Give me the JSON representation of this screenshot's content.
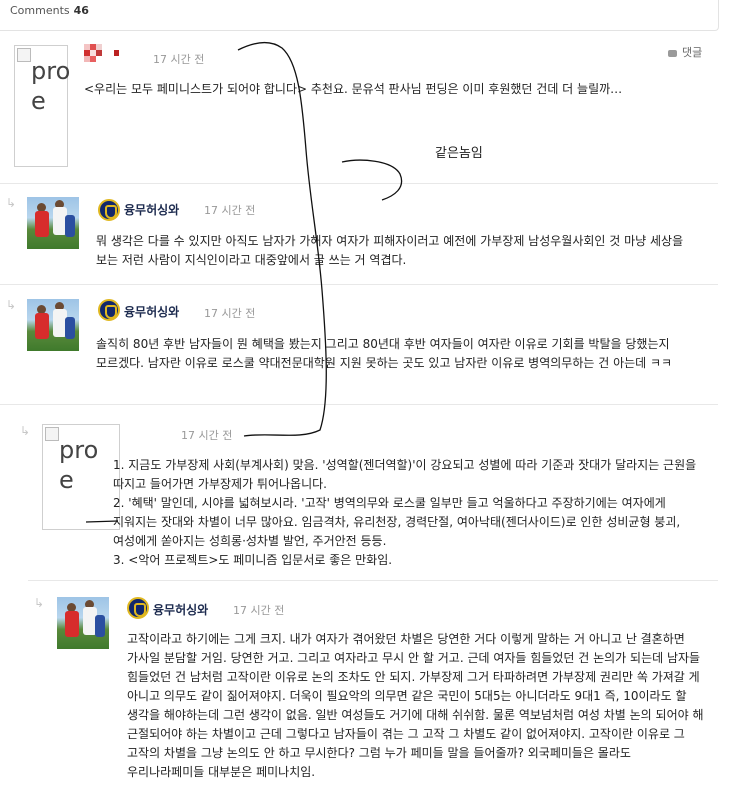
{
  "header": {
    "comments_label": "Comments",
    "comments_count": "46"
  },
  "reply_label": "댓글",
  "annotation_text": "같은놈임",
  "comments": [
    {
      "avatar_alt": "pro\ne",
      "author": "",
      "time": "17 시간 전",
      "text": "<우리는 모두 페미니스트가 되어야 합니다> 추천요. 문유석 판사님 펀딩은 이미 후원했던 건데 더 늘릴까…"
    },
    {
      "author": "융무허싱와",
      "time": "17 시간 전",
      "text": "뭐 생각은 다를 수 있지만 아직도 남자가 가해자 여자가 피해자이러고 예전에 가부장제 남성우월사회인 것 마냥 세상을 보는 저런 사람이 지식인이라고 대중앞에서 글 쓰는 거 역겹다."
    },
    {
      "author": "융무허싱와",
      "time": "17 시간 전",
      "text": "솔직히 80년 후반 남자들이 뭔 혜택을 봤는지 그리고 80년대 후반 여자들이 여자란 이유로 기회를 박탈을 당했는지 모르겠다. 남자란 이유로 로스쿨 약대전문대학원 지원 못하는 곳도 있고 남자란 이유로 병역의무하는 건 아는데 ㅋㅋ"
    },
    {
      "avatar_alt": "pro\ne",
      "author": "",
      "time": "17 시간 전",
      "lines": [
        "1. 지금도 가부장제 사회(부계사회) 맞음. '성역할(젠더역할)'이 강요되고 성별에 따라 기준과 잣대가 달라지는 근원을 따지고 들어가면 가부장제가 튀어나옵니다.",
        "2. '혜택' 말인데, 시야를 넓혀보시라. '고작' 병역의무와 로스쿨 일부만 들고 억울하다고 주장하기에는 여자에게 지워지는 잣대와 차별이 너무 많아요. 임금격차, 유리천장, 경력단절, 여아낙태(젠더사이드)로 인한 성비균형 붕괴, 여성에게 쏟아지는 성희롱·성차별 발언, 주거안전 등등.",
        "3. <악어 프로젝트>도 페미니즘 입문서로 좋은 만화임."
      ]
    },
    {
      "author": "융무허싱와",
      "time": "17 시간 전",
      "text": "고작이라고 하기에는 그게 크지. 내가 여자가 겪어왔던 차별은 당연한 거다 이렇게 말하는 거 아니고 난 결혼하면 가사일 분담할 거임. 당연한 거고. 그리고 여자라고 무시 안 할 거고. 근데 여자들 힘들었던 건 논의가 되는데 남자들 힘들었던 건 남처럼 고작이란 이유로 논의 조차도 안 되지. 가부장제 그거 타파하려면 가부장제 권리만 쏙 가져갈 게 아니고 의무도 같이 짊어져야지. 더욱이 필요악의 의무면 같은 국민이 5대5는 아니더라도 9대1 즉, 10이라도 할 생각을 해야하는데 그런 생각이 없음. 일반 여성들도 거기에 대해 쉬쉬함. 물론 역보넘처럼 여성 차별 논의 되어야 해 근절되어야 하는 차별이고 근데 그렇다고 남자들이 겪는 그 고작 그 차별도 같이 없어져야지. 고작이란 이유로 그 고작의 차별을 그냥 논의도 안 하고 무시한다? 그럼 누가 페미들 말을 들어줄까? 외국페미들은 몰라도 우리나라페미들 대부분은 페미나치임."
    }
  ]
}
